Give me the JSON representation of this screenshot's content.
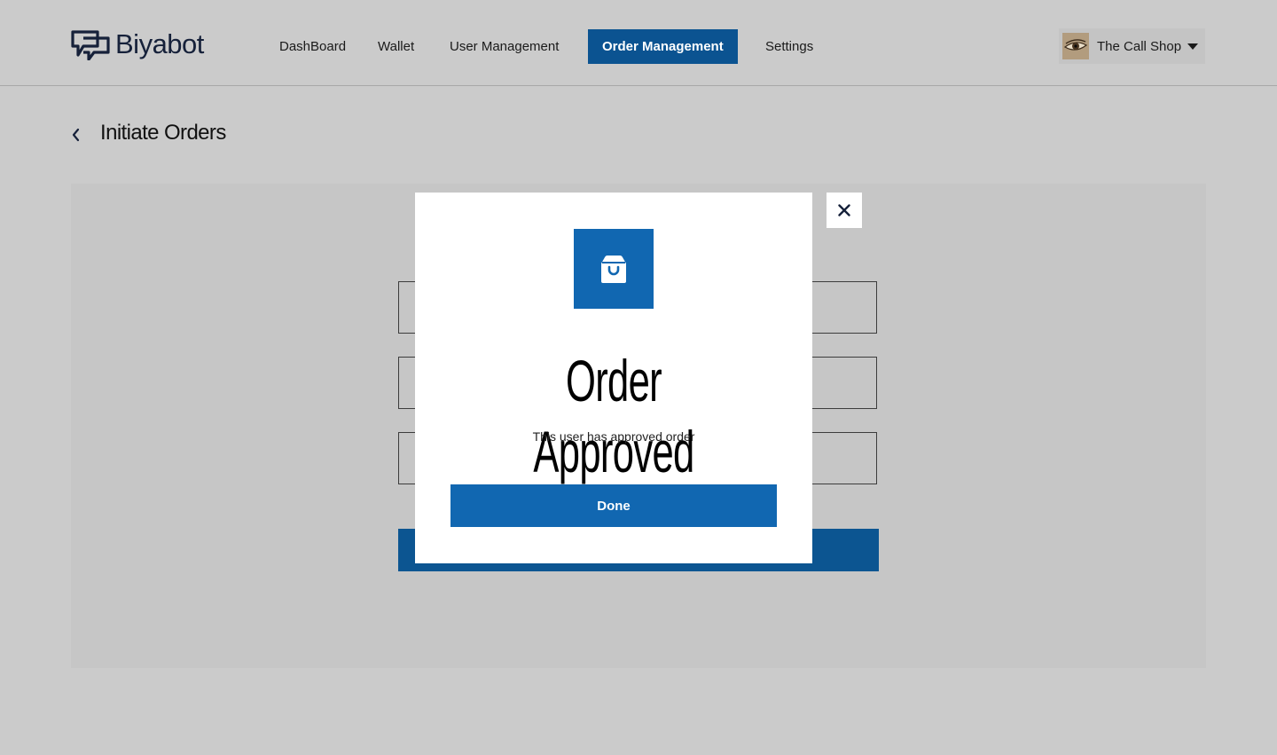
{
  "brand": {
    "name": "Biyabot",
    "logo_icon": "chat-bubbles-logo-icon"
  },
  "nav": {
    "items": [
      {
        "label": "DashBoard",
        "active": false
      },
      {
        "label": "Wallet",
        "active": false
      },
      {
        "label": "User Management",
        "active": false
      },
      {
        "label": "Order Management",
        "active": true
      },
      {
        "label": "Settings",
        "active": false
      }
    ]
  },
  "user": {
    "shop_name": "The Call Shop",
    "avatar_icon": "eye-avatar-image",
    "menu_icon": "caret-down-icon"
  },
  "page": {
    "title": "Initiate Orders",
    "back_icon": "chevron-left-icon"
  },
  "modal": {
    "icon": "shopping-bag-icon",
    "title": "Order Approved",
    "subtitle": "This user has approved order",
    "done_label": "Done",
    "close_icon": "close-icon"
  },
  "colors": {
    "accent": "#1167b1",
    "nav_active": "#0b5391",
    "overlay_background": "#cbcbcb",
    "brand_text": "#16213a"
  }
}
